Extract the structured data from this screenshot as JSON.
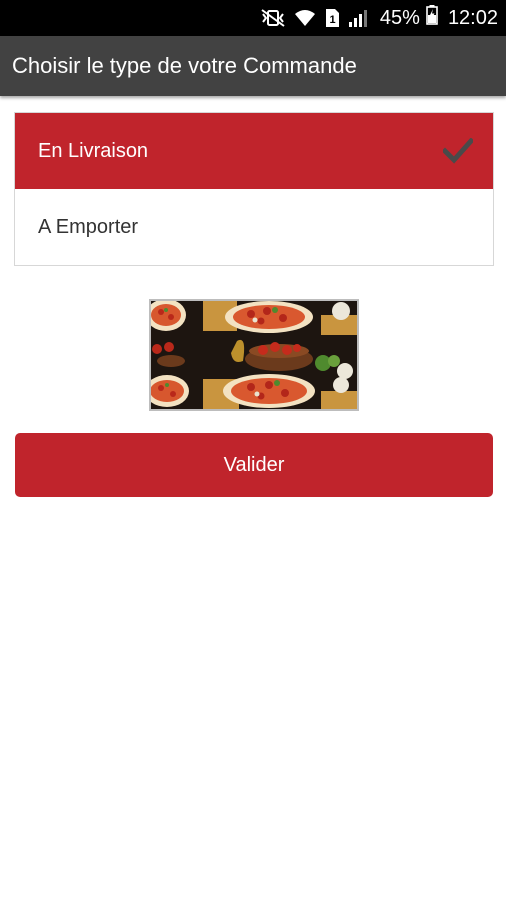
{
  "status_bar": {
    "battery_percent": "45%",
    "time": "12:02",
    "icons": [
      "mute-vibrate-icon",
      "wifi-icon",
      "sim-icon",
      "signal-icon",
      "battery-icon"
    ]
  },
  "app_bar": {
    "title": "Choisir le type de votre Commande"
  },
  "order_types": [
    {
      "label": "En Livraison",
      "selected": true
    },
    {
      "label": "A Emporter",
      "selected": false
    }
  ],
  "banner": {
    "image": "pizza-collage"
  },
  "validate_label": "Valider",
  "colors": {
    "accent": "#c0242c",
    "app_bar": "#424242",
    "status_bar": "#000000"
  }
}
